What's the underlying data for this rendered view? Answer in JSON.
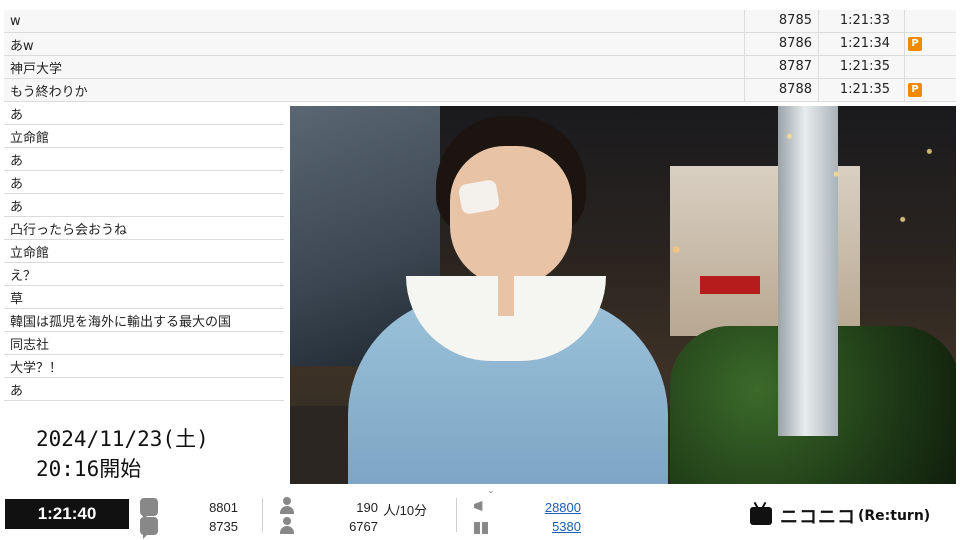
{
  "comments": [
    {
      "text": "w",
      "number": "8785",
      "time": "1:21:33",
      "premium": false
    },
    {
      "text": "あw",
      "number": "8786",
      "time": "1:21:34",
      "premium": true
    },
    {
      "text": "神戸大学",
      "number": "8787",
      "time": "1:21:35",
      "premium": false
    },
    {
      "text": "もう終わりか",
      "number": "8788",
      "time": "1:21:35",
      "premium": true
    },
    {
      "text": "あ"
    },
    {
      "text": "立命館"
    },
    {
      "text": "あ"
    },
    {
      "text": "あ"
    },
    {
      "text": "あ"
    },
    {
      "text": "凸行ったら会おうね"
    },
    {
      "text": "立命館"
    },
    {
      "text": "え？"
    },
    {
      "text": "草"
    },
    {
      "text": "韓国は孤児を海外に輸出する最大の国"
    },
    {
      "text": "同志社"
    },
    {
      "text": "大学？！"
    },
    {
      "text": "あ"
    }
  ],
  "premium_badge": "P",
  "caption": {
    "date": "2024/11/23(土)",
    "start": "20:16開始"
  },
  "status": {
    "elapsed": "1:21:40",
    "comments_total": "8801",
    "comments_other": "8735",
    "viewers_recent": "190",
    "viewers_unit": "人/10分",
    "viewers_total": "6767",
    "ad_points": "28800",
    "gift_points": "5380"
  },
  "logo": {
    "brand": "ニコニコ",
    "sub": "(Re:turn)"
  },
  "colors": {
    "premium": "#f08a00",
    "link": "#1a5fb4",
    "elapsed_bg": "#111111"
  }
}
